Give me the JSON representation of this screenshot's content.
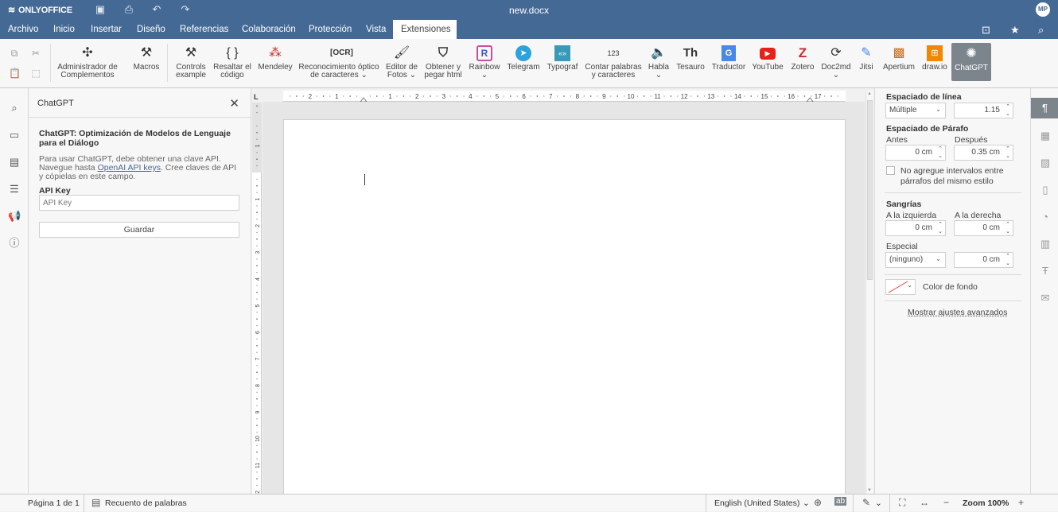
{
  "app": {
    "logo": "ONLYOFFICE",
    "doc_title": "new.docx",
    "avatar": "MP"
  },
  "menu": {
    "items": [
      "Archivo",
      "Inicio",
      "Insertar",
      "Diseño",
      "Referencias",
      "Colaboración",
      "Protección",
      "Vista",
      "Extensiones"
    ],
    "active": "Extensiones"
  },
  "toolbar": {
    "plugins": [
      {
        "l1": "Administrador de",
        "l2": "Complementos",
        "icon": "puzzle-icon"
      },
      {
        "l1": "Macros",
        "l2": "",
        "icon": "tools-icon"
      },
      {
        "l1": "Controls",
        "l2": "example",
        "icon": "tools-icon"
      },
      {
        "l1": "Resaltar el",
        "l2": "código",
        "icon": "braces-icon"
      },
      {
        "l1": "Mendeley",
        "l2": "",
        "icon": "mendeley-icon"
      },
      {
        "l1": "Reconocimiento óptico",
        "l2": "de caracteres",
        "icon": "ocr-icon"
      },
      {
        "l1": "Editor de",
        "l2": "Fotos",
        "icon": "photo-editor-icon"
      },
      {
        "l1": "Obtener y",
        "l2": "pegar html",
        "icon": "html-icon"
      },
      {
        "l1": "Rainbow",
        "l2": "",
        "icon": "rainbow-icon"
      },
      {
        "l1": "Telegram",
        "l2": "",
        "icon": "telegram-icon"
      },
      {
        "l1": "Typograf",
        "l2": "",
        "icon": "typograf-icon"
      },
      {
        "l1": "Contar palabras",
        "l2": "y caracteres",
        "icon": "count-icon"
      },
      {
        "l1": "Habla",
        "l2": "",
        "icon": "speaker-icon"
      },
      {
        "l1": "Tesauro",
        "l2": "",
        "icon": "thesaurus-icon"
      },
      {
        "l1": "Traductor",
        "l2": "",
        "icon": "translate-icon"
      },
      {
        "l1": "YouTube",
        "l2": "",
        "icon": "youtube-icon"
      },
      {
        "l1": "Zotero",
        "l2": "",
        "icon": "zotero-icon"
      },
      {
        "l1": "Doc2md",
        "l2": "",
        "icon": "doc2md-icon"
      },
      {
        "l1": "Jitsi",
        "l2": "",
        "icon": "jitsi-icon"
      },
      {
        "l1": "Apertium",
        "l2": "",
        "icon": "apertium-icon"
      },
      {
        "l1": "draw.io",
        "l2": "",
        "icon": "drawio-icon"
      },
      {
        "l1": "ChatGPT",
        "l2": "",
        "icon": "chatgpt-icon"
      }
    ]
  },
  "plugin_panel": {
    "title": "ChatGPT",
    "heading": "ChatGPT: Optimización de Modelos de Lenguaje para el Diálogo",
    "text_before": "Para usar ChatGPT, debe obtener una clave API. Navegue hasta ",
    "link": "OpenAI API keys",
    "text_after": ". Cree claves de API y cópielas en este campo.",
    "api_label": "API Key",
    "api_placeholder": "API Key",
    "save_label": "Guardar"
  },
  "ruler": {
    "corner": "L",
    "labels": [
      "2",
      "1",
      "1",
      "2",
      "3",
      "4",
      "5",
      "6",
      "7",
      "8",
      "9",
      "10",
      "11",
      "12",
      "13",
      "14",
      "15",
      "16",
      "17"
    ],
    "vlabels": [
      "1",
      "1",
      "2",
      "3",
      "4",
      "5",
      "6",
      "7",
      "8",
      "9",
      "10",
      "11",
      "2"
    ]
  },
  "paragraph": {
    "line_spacing_title": "Espaciado de línea",
    "line_spacing_type": "Múltiple",
    "line_spacing_value": "1.15",
    "para_spacing_title": "Espaciado de Párafo",
    "before_label": "Antes",
    "before_value": "0 cm",
    "after_label": "Después",
    "after_value": "0.35 cm",
    "no_interval_label": "No agregue intervalos entre párrafos del mismo estilo",
    "indent_title": "Sangrías",
    "left_label": "A la izquierda",
    "left_value": "0 cm",
    "right_label": "A la derecha",
    "right_value": "0 cm",
    "special_label": "Especial",
    "special_value": "(ninguno)",
    "special_amount": "0 cm",
    "bg_color_label": "Color de fondo",
    "advanced_link": "Mostrar ajustes avanzados"
  },
  "status": {
    "page": "Página 1 de 1",
    "word_count": "Recuento de palabras",
    "language": "English (United States)",
    "zoom": "Zoom 100%"
  }
}
